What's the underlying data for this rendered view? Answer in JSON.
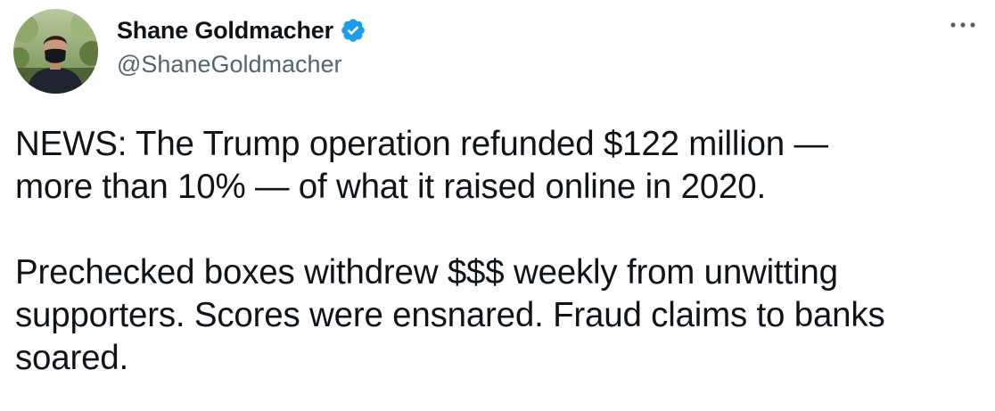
{
  "author": {
    "display_name": "Shane Goldmacher",
    "handle": "@ShaneGoldmacher",
    "verified": true,
    "verified_icon": "verified-badge-icon",
    "avatar_icon": "avatar-photo"
  },
  "menu": {
    "more_icon": "more-options-icon"
  },
  "tweet": {
    "paragraph_1": "NEWS: The Trump operation refunded $122 million —\nmore than 10% — of what it raised online in 2020.",
    "paragraph_2": "Prechecked boxes withdrew $$$ weekly from unwitting\nsupporters. Scores were ensnared. Fraud claims to banks\nsoared."
  },
  "colors": {
    "text": "#0f1419",
    "secondary": "#536471",
    "verified": "#1d9bf0",
    "background": "#ffffff"
  }
}
